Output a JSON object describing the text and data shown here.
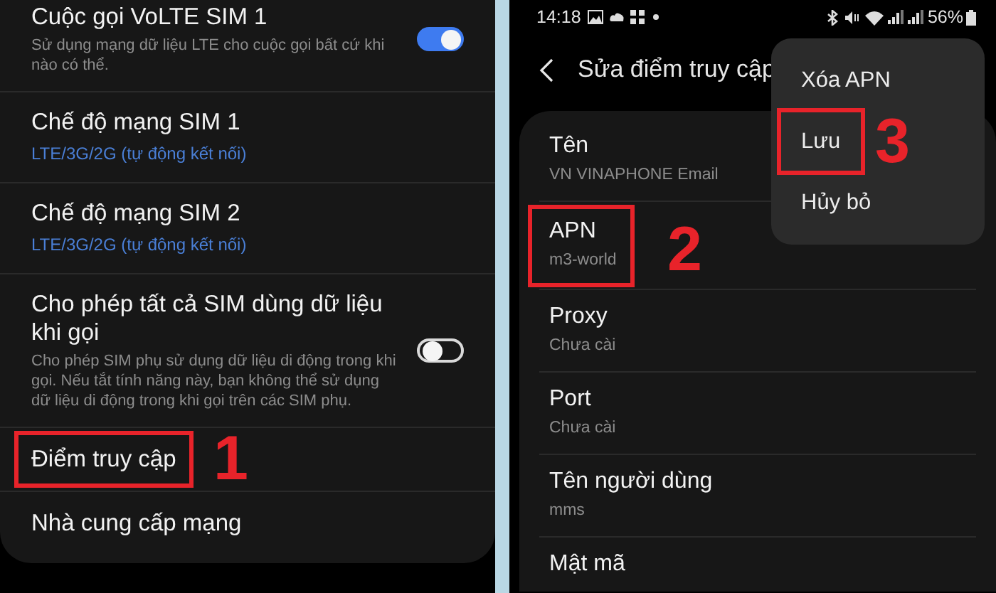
{
  "left_panel": {
    "items": [
      {
        "kind": "toggle",
        "title": "Cuộc gọi VoLTE SIM 1",
        "description": "Sử dụng mạng dữ liệu LTE cho cuộc gọi bất cứ khi nào có thể.",
        "on": true,
        "highlighted": false
      },
      {
        "kind": "value",
        "title": "Chế độ mạng SIM 1",
        "value": "LTE/3G/2G (tự động kết nối)",
        "highlighted": false
      },
      {
        "kind": "value",
        "title": "Chế độ mạng SIM 2",
        "value": "LTE/3G/2G (tự động kết nối)",
        "highlighted": false
      },
      {
        "kind": "toggle",
        "title": "Cho phép tất cả SIM dùng dữ liệu khi gọi",
        "description": "Cho phép SIM phụ sử dụng dữ liệu di động trong khi gọi. Nếu tắt tính năng này, bạn không thể sử dụng dữ liệu di động trong khi gọi trên các SIM phụ.",
        "on": false,
        "highlighted": false
      },
      {
        "kind": "link",
        "title": "Điểm truy cập",
        "highlighted": true,
        "step": "1"
      },
      {
        "kind": "link",
        "title": "Nhà cung cấp mạng",
        "highlighted": false
      }
    ]
  },
  "right_panel": {
    "status_bar": {
      "time": "14:18",
      "battery": "56%"
    },
    "header": {
      "title": "Sửa điểm truy cập"
    },
    "fields": [
      {
        "label": "Tên",
        "value": "VN VINAPHONE Email",
        "highlighted": false
      },
      {
        "label": "APN",
        "value": "m3-world",
        "highlighted": true,
        "step": "2"
      },
      {
        "label": "Proxy",
        "value": "Chưa cài",
        "highlighted": false
      },
      {
        "label": "Port",
        "value": "Chưa cài",
        "highlighted": false
      },
      {
        "label": "Tên người dùng",
        "value": "mms",
        "highlighted": false
      },
      {
        "label": "Mật mã",
        "highlighted": false
      }
    ],
    "menu": {
      "items": [
        {
          "label": "Xóa APN",
          "highlighted": false
        },
        {
          "label": "Lưu",
          "highlighted": true,
          "step": "3"
        },
        {
          "label": "Hủy bỏ",
          "highlighted": false
        }
      ]
    }
  }
}
